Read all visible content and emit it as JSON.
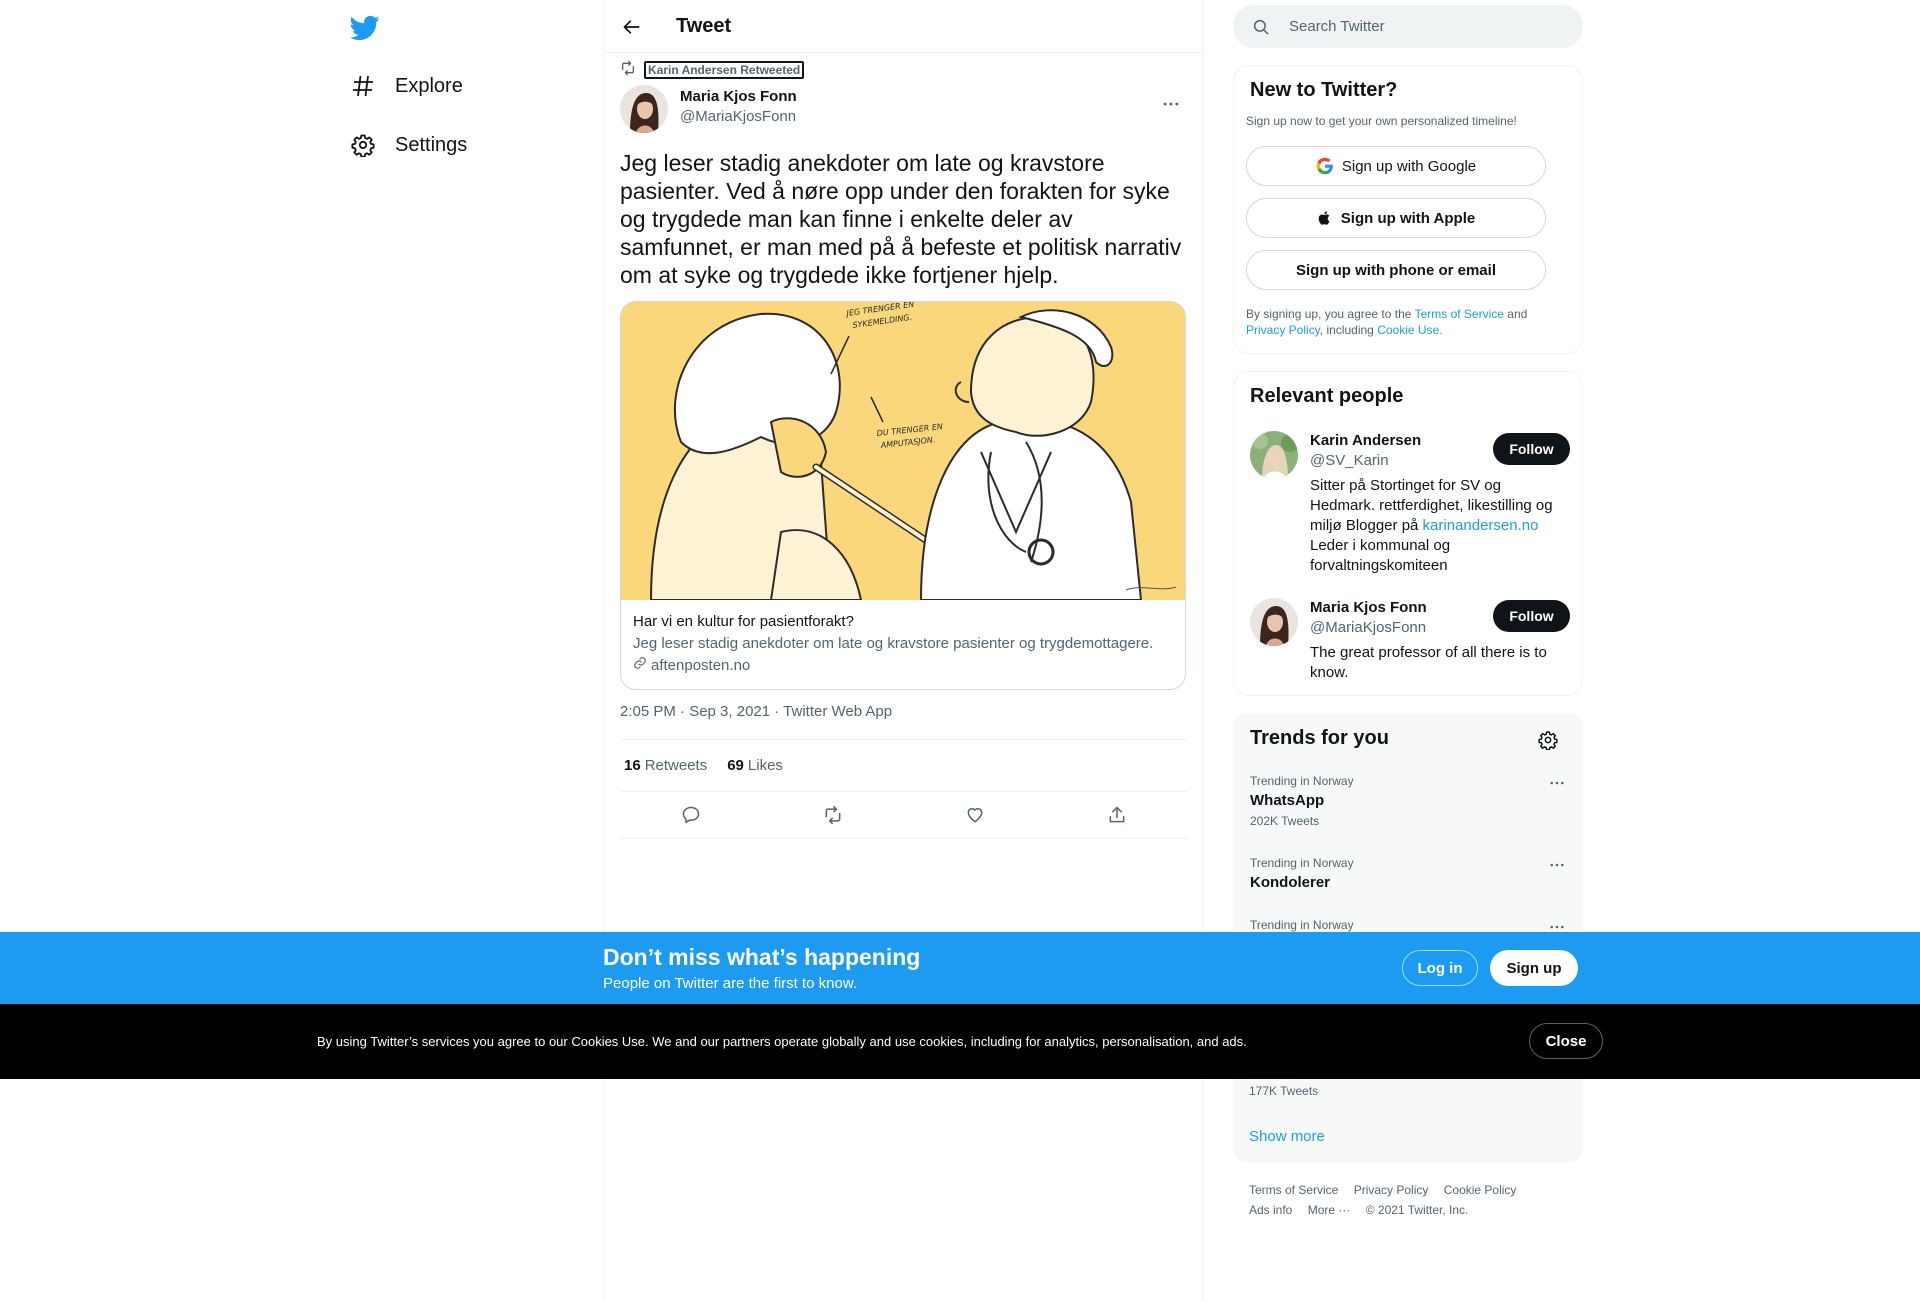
{
  "nav": {
    "logo_icon": "twitter-bird-icon",
    "items": [
      {
        "label": "Explore",
        "icon": "hashtag-icon"
      },
      {
        "label": "Settings",
        "icon": "gear-icon"
      }
    ]
  },
  "header": {
    "title": "Tweet"
  },
  "tweet": {
    "retweeted_by": "Karin Andersen Retweeted",
    "author_name": "Maria Kjos Fonn",
    "author_handle": "@MariaKjosFonn",
    "text": "Jeg leser stadig anekdoter om late og kravstore pasienter. Ved å nøre opp under den forakten for syke og trygdede man kan finne i enkelte deler av samfunnet, er man med på å befeste et politisk narrativ om at syke og trygdede ikke fortjener hjelp.",
    "card": {
      "image_bubble_1": "JEG TRENGER EN SYKEMELDING.",
      "image_bubble_2": "DU TRENGER EN AMPUTASJON.",
      "title": "Har vi en kultur for pasientforakt?",
      "description": "Jeg leser stadig anekdoter om late og kravstore pasienter og trygdemottagere.",
      "domain": "aftenposten.no"
    },
    "meta": "2:05 PM · Sep 3, 2021 · Twitter Web App",
    "retweets_count": "16",
    "retweets_label": "Retweets",
    "likes_count": "69",
    "likes_label": "Likes"
  },
  "search": {
    "placeholder": "Search Twitter"
  },
  "new_to_twitter": {
    "title": "New to Twitter?",
    "subtitle": "Sign up now to get your own personalized timeline!",
    "google_label": "Sign up with Google",
    "apple_label": "Sign up with Apple",
    "phone_label": "Sign up with phone or email",
    "legal_prefix": "By signing up, you agree to the",
    "terms": "Terms of Service",
    "and": "and",
    "privacy": "Privacy Policy",
    "including": ", including",
    "cookie_use": "Cookie Use."
  },
  "relevant": {
    "title": "Relevant people",
    "people": [
      {
        "name": "Karin Andersen",
        "handle": "@SV_Karin",
        "bio_before": "Sitter på Stortinget for SV og Hedmark. rettferdighet, likestilling og miljø Blogger på ",
        "bio_link": "karinandersen.no",
        "bio_after": " Leder i kommunal og forvaltningskomiteen",
        "follow": "Follow"
      },
      {
        "name": "Maria Kjos Fonn",
        "handle": "@MariaKjosFonn",
        "bio": "The great professor of all there is to know.",
        "follow": "Follow"
      }
    ]
  },
  "trends": {
    "title": "Trends for you",
    "items": [
      {
        "context": "Trending in Norway",
        "name": "WhatsApp",
        "count": "202K Tweets"
      },
      {
        "context": "Trending in Norway",
        "name": "Kondolerer",
        "count": ""
      },
      {
        "context": "Trending in Norway",
        "name": "",
        "count": ""
      }
    ],
    "lone_count": "177K Tweets",
    "show_more": "Show more"
  },
  "footer": {
    "links": [
      "Terms of Service",
      "Privacy Policy",
      "Cookie Policy",
      "Ads info",
      "More ···"
    ],
    "copyright": "© 2021 Twitter, Inc."
  },
  "promo": {
    "title": "Don’t miss what’s happening",
    "subtitle": "People on Twitter are the first to know.",
    "login": "Log in",
    "signup": "Sign up"
  },
  "cookie": {
    "text": "By using Twitter’s services you agree to our Cookies Use. We and our partners operate globally and use cookies, including for analytics, personalisation, and ads.",
    "close": "Close"
  },
  "colors": {
    "brand_blue": "#1d9bf0",
    "text_primary": "#0f1419",
    "text_secondary": "#536471",
    "card_image_bg": "#fad77a",
    "cookie_bg": "#000000"
  }
}
